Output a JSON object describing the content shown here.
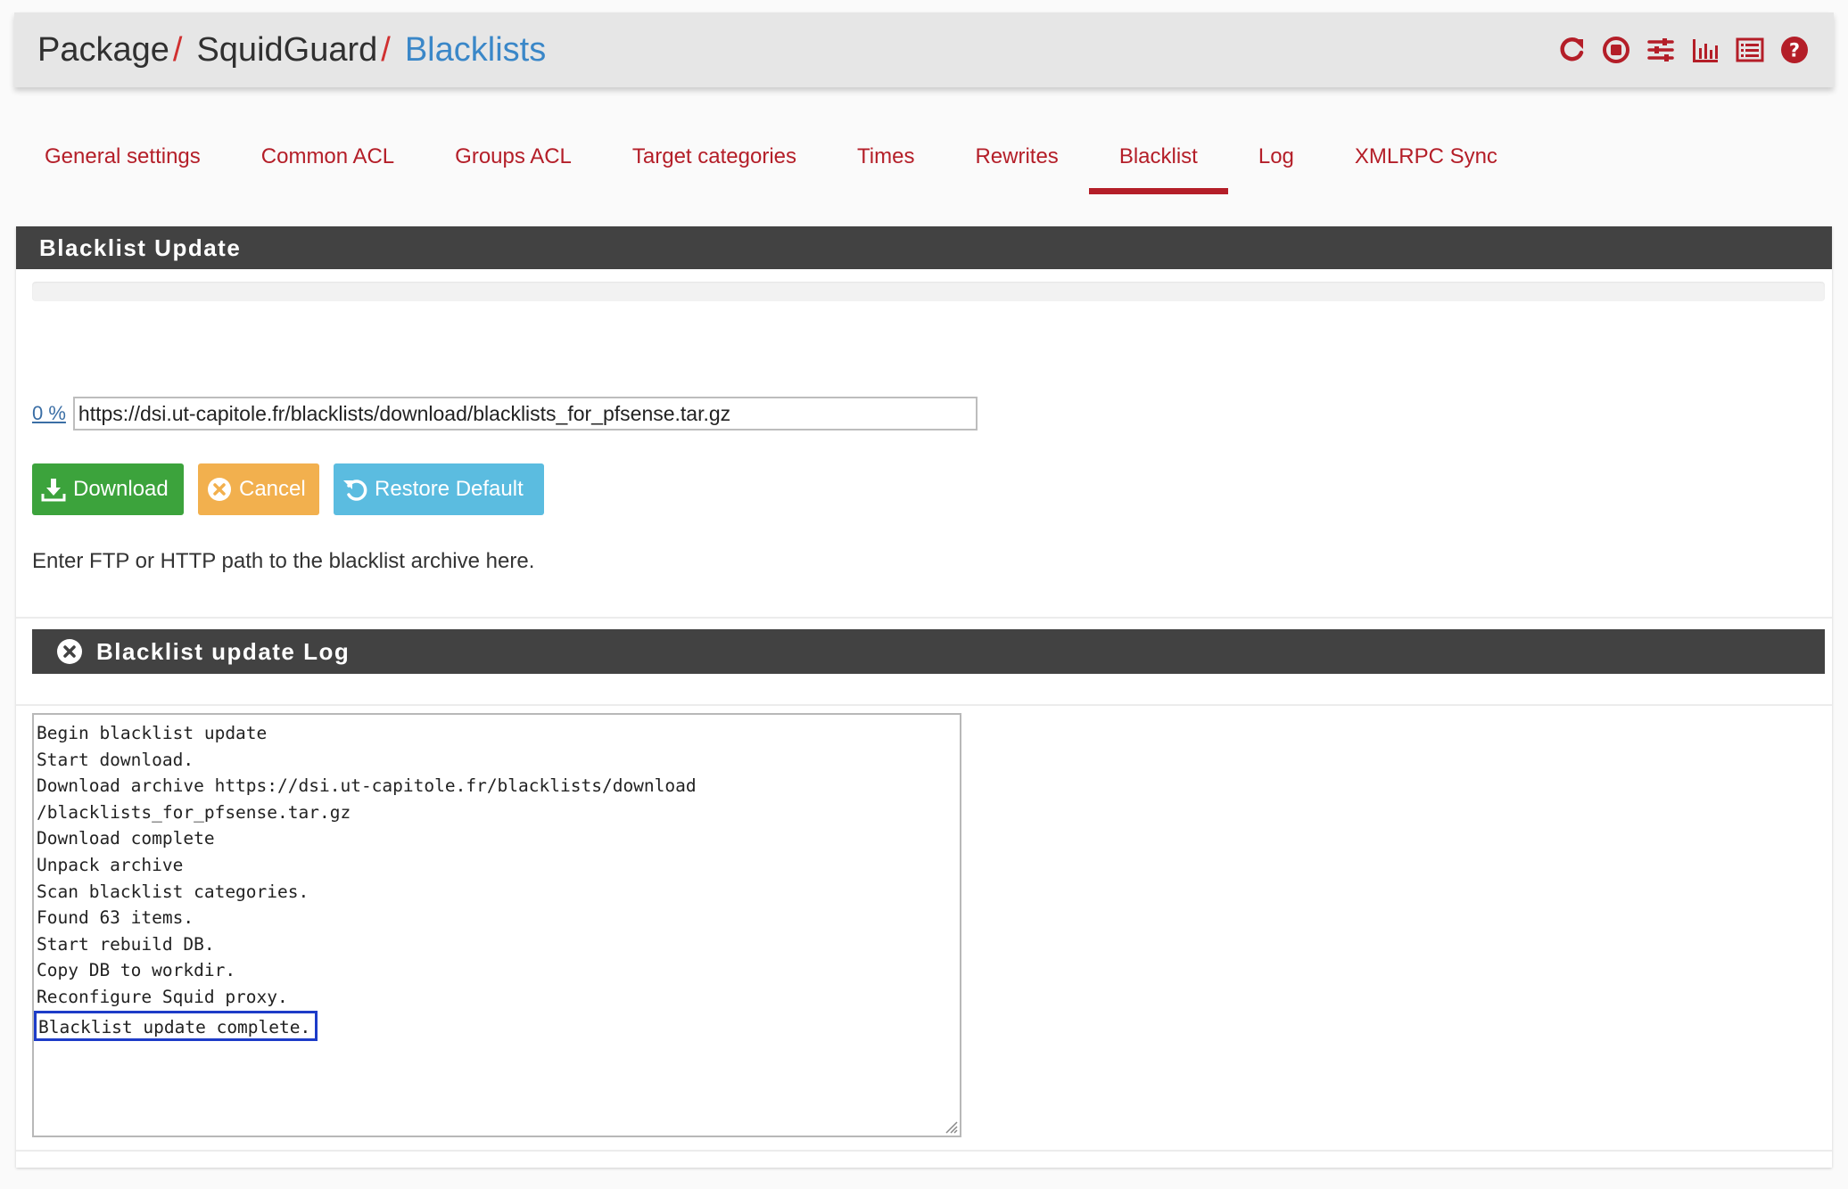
{
  "header": {
    "breadcrumb": [
      "Package",
      "SquidGuard",
      "Blacklists"
    ],
    "separator": "/",
    "icons": [
      "reload-icon",
      "stop-icon",
      "settings-sliders-icon",
      "chart-icon",
      "log-list-icon",
      "help-icon"
    ],
    "icon_color": "#b41e28"
  },
  "tabs": [
    {
      "label": "General settings"
    },
    {
      "label": "Common ACL"
    },
    {
      "label": "Groups ACL"
    },
    {
      "label": "Target categories"
    },
    {
      "label": "Times"
    },
    {
      "label": "Rewrites"
    },
    {
      "label": "Blacklist",
      "active": true
    },
    {
      "label": "Log"
    },
    {
      "label": "XMLRPC Sync"
    }
  ],
  "update_panel": {
    "title": "Blacklist Update",
    "progress_fraction": 0,
    "percent_label": "0 %",
    "url_value": "https://dsi.ut-capitole.fr/blacklists/download/blacklists_for_pfsense.tar.gz",
    "buttons": {
      "download": "Download",
      "cancel": "Cancel",
      "restore": "Restore Default"
    },
    "help": "Enter FTP or HTTP path to the blacklist archive here."
  },
  "log_panel": {
    "title": "Blacklist update Log",
    "lines": [
      "Begin blacklist update",
      "Start download.",
      "Download archive https://dsi.ut-capitole.fr/blacklists/download",
      "/blacklists_for_pfsense.tar.gz",
      "Download complete",
      "Unpack archive",
      "Scan blacklist categories.",
      "Found 63 items.",
      "Start rebuild DB.",
      "Copy DB to workdir.",
      "Reconfigure Squid proxy.",
      "Blacklist update complete."
    ],
    "highlighted_line": 11
  },
  "colors": {
    "accent_red": "#b41e28",
    "link_blue": "#3a87c8",
    "success": "#3ca33c",
    "warning": "#f2b04e",
    "info": "#5bbce0",
    "heading_bg": "#424242",
    "highlight_box": "#1d3cc8"
  }
}
